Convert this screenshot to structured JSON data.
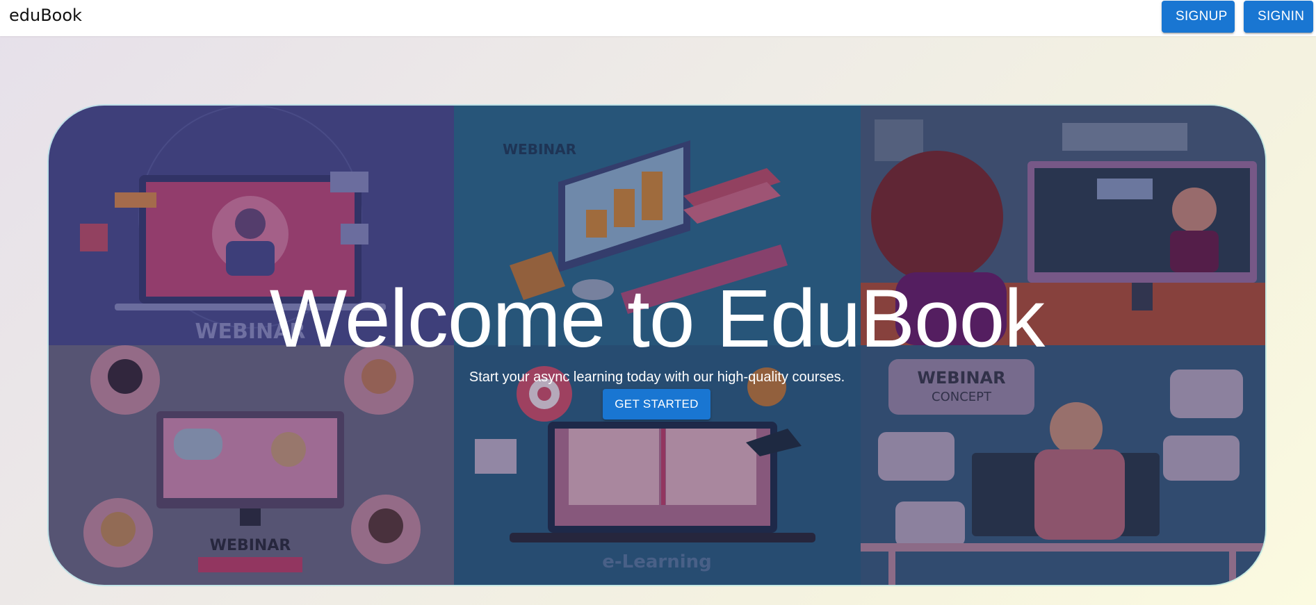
{
  "header": {
    "brand": "eduBook",
    "signup_label": "SIGNUP",
    "signin_label": "SIGNIN"
  },
  "hero": {
    "title": "Welcome to EduBook",
    "subtitle": "Start your async learning today with our high-quality courses.",
    "cta_label": "GET STARTED",
    "panels": [
      {
        "caption": "WEBINAR"
      },
      {
        "caption": "WEBINAR"
      },
      {
        "caption": ""
      },
      {
        "caption": "WEBINAR"
      },
      {
        "caption": "e-Learning"
      },
      {
        "caption": "WEBINAR CONCEPT"
      }
    ]
  },
  "colors": {
    "primary": "#1976d2",
    "header_bg": "#ffffff"
  }
}
